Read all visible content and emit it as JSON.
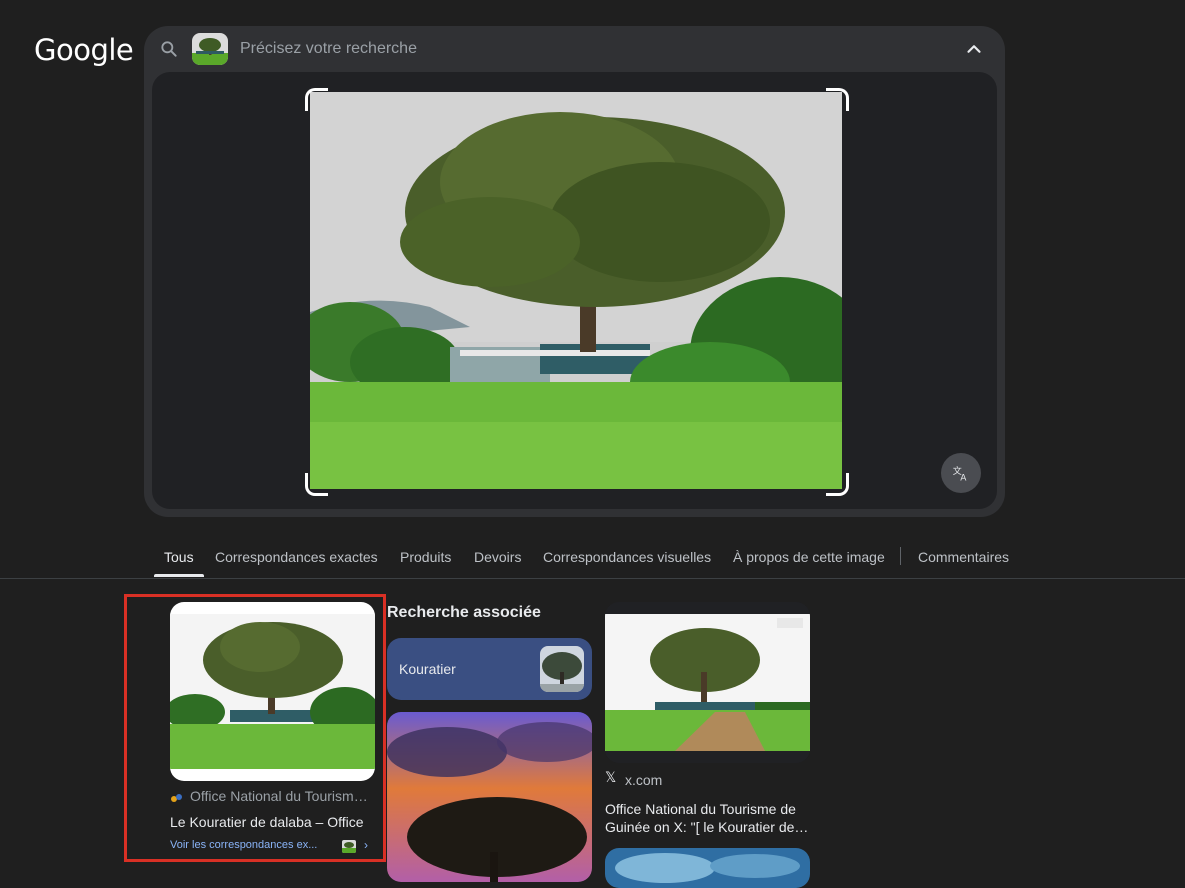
{
  "logo": "Google",
  "search": {
    "placeholder": "Précisez votre recherche",
    "icon": "search-icon",
    "collapse_icon": "chevron-up-icon",
    "translate_icon": "translate-icon"
  },
  "tabs": [
    {
      "label": "Tous",
      "active": true
    },
    {
      "label": "Correspondances exactes"
    },
    {
      "label": "Produits"
    },
    {
      "label": "Devoirs"
    },
    {
      "label": "Correspondances visuelles"
    },
    {
      "label": "À propos de cette image"
    },
    {
      "label": "Commentaires"
    }
  ],
  "results": {
    "first": {
      "source": "Office National du Tourisme de Guinée",
      "title": "Le Kouratier de dalaba – Office",
      "match_link": "Voir les correspondances ex..."
    },
    "related": {
      "heading": "Recherche associée",
      "chip_label": "Kouratier"
    },
    "third": {
      "source": "x.com",
      "title": "Office National du Tourisme de Guinée on X: \"[ le Kouratier de…"
    }
  },
  "colors": {
    "background": "#1f1f1f",
    "panel": "#303134",
    "link": "#8ab4f8",
    "chip": "#3a4f82",
    "highlight": "#d93025"
  }
}
